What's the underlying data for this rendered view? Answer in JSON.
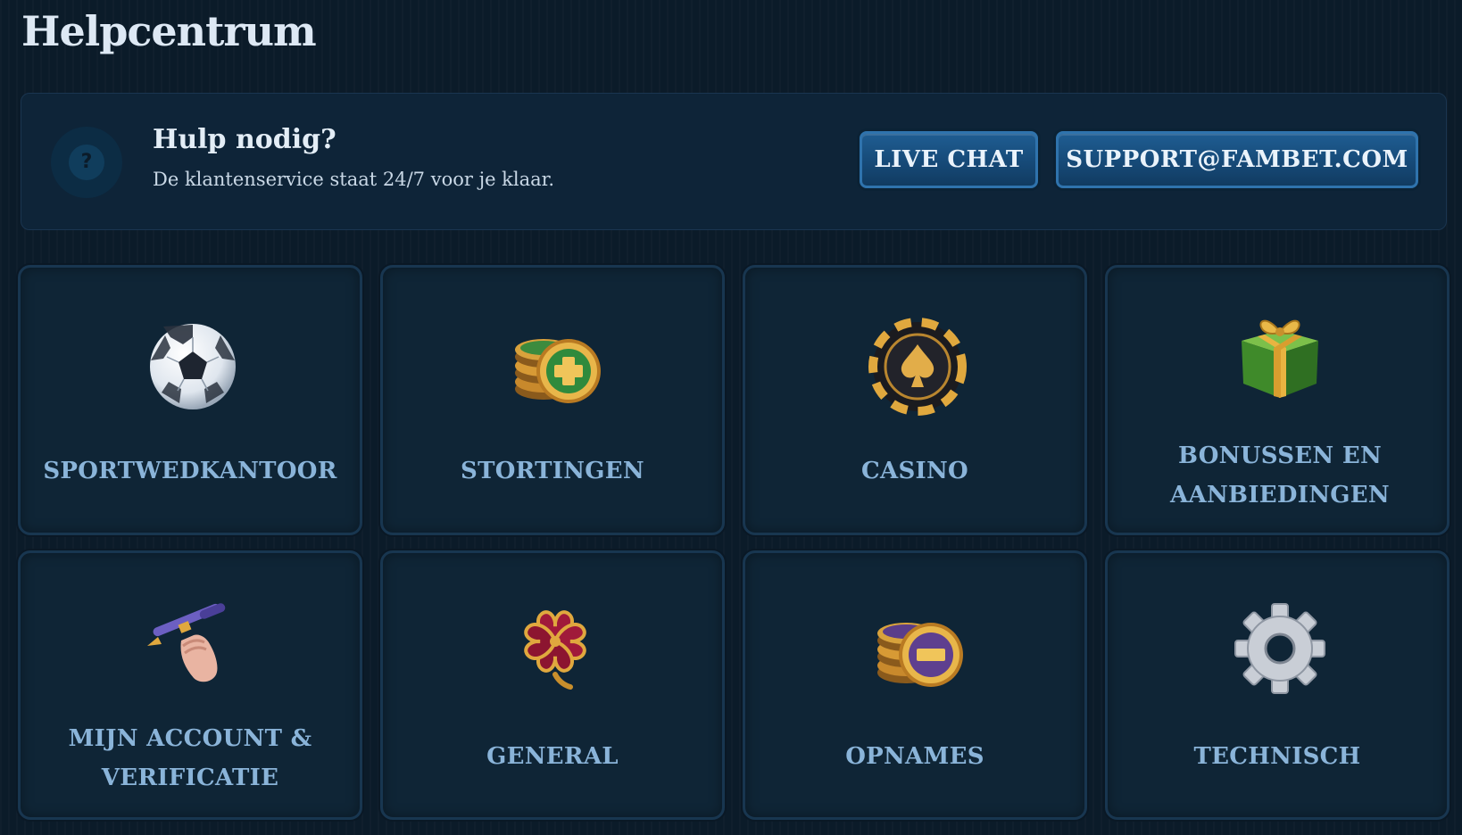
{
  "page": {
    "title": "Helpcentrum"
  },
  "help_banner": {
    "icon": "question-circle-icon",
    "title": "Hulp nodig?",
    "subtitle": "De klantenservice staat 24/7 voor je klaar.",
    "live_chat_label": "LIVE CHAT",
    "email_label": "SUPPORT@FAMBET.COM"
  },
  "categories": [
    {
      "label": "SPORTWEDKANTOOR",
      "icon": "soccer-ball-icon"
    },
    {
      "label": "STORTINGEN",
      "icon": "coins-plus-icon"
    },
    {
      "label": "CASINO",
      "icon": "casino-chip-icon"
    },
    {
      "label": "BONUSSEN EN AANBIEDINGEN",
      "icon": "gift-box-icon"
    },
    {
      "label": "MIJN ACCOUNT & VERIFICATIE",
      "icon": "hand-pen-icon"
    },
    {
      "label": "GENERAL",
      "icon": "four-leaf-clover-icon"
    },
    {
      "label": "OPNAMES",
      "icon": "coins-minus-icon"
    },
    {
      "label": "TECHNISCH",
      "icon": "gear-icon"
    }
  ],
  "colors": {
    "background": "#0b1b29",
    "card": "#0f2536",
    "card_label": "#8ab4d9",
    "button": "#1a5486"
  }
}
